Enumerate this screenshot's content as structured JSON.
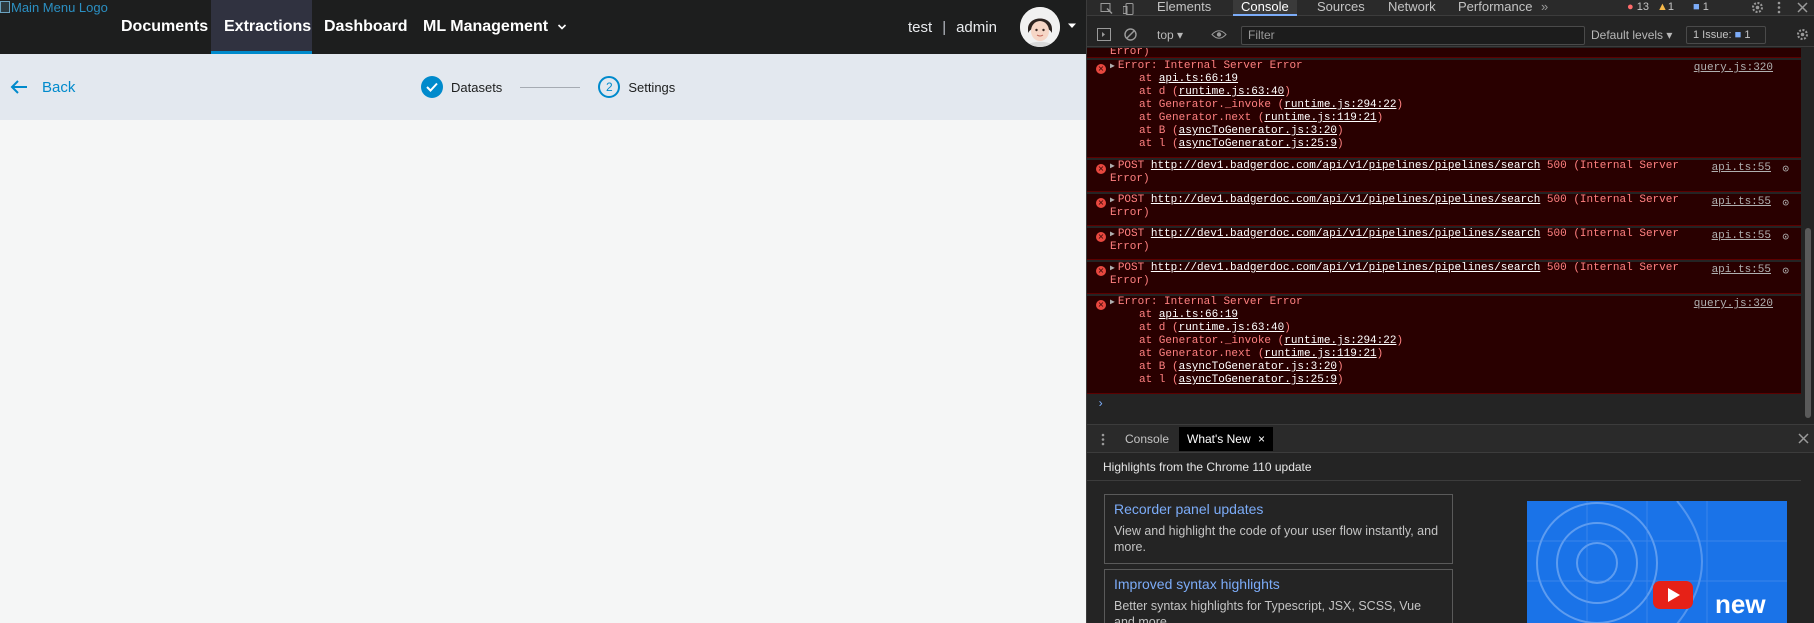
{
  "app": {
    "logo_alt": "Main Menu Logo",
    "nav": [
      {
        "label": "Documents"
      },
      {
        "label": "Extractions"
      },
      {
        "label": "Dashboard"
      },
      {
        "label": "ML Management"
      }
    ],
    "active_nav": "Extractions",
    "user": {
      "tenant": "test",
      "separator": "|",
      "name": "admin"
    },
    "back_label": "Back",
    "steps": [
      {
        "label": "Datasets",
        "status": "done"
      },
      {
        "num": "2",
        "label": "Settings",
        "status": "current"
      }
    ]
  },
  "devtools": {
    "tabs": [
      "Elements",
      "Console",
      "Sources",
      "Network",
      "Performance"
    ],
    "active_tab": "Console",
    "more_tabs": "»",
    "counts": {
      "errors": "13",
      "warnings": "1",
      "messages": "1"
    },
    "toolbar": {
      "context": "top",
      "filter_placeholder": "Filter",
      "levels": "Default levels",
      "issues": "1 Issue:",
      "issue_count": "1"
    },
    "console_lines": {
      "cut_off": "Error)",
      "error1": {
        "head": "Error: Internal Server Error",
        "src": "query.js:320",
        "trace": [
          [
            "at ",
            "api.ts:66:19",
            ""
          ],
          [
            "at d (",
            "runtime.js:63:40",
            ")"
          ],
          [
            "at Generator._invoke (",
            "runtime.js:294:22",
            ")"
          ],
          [
            "at Generator.next (",
            "runtime.js:119:21",
            ")"
          ],
          [
            "at B (",
            "asyncToGenerator.js:3:20",
            ")"
          ],
          [
            "at l (",
            "asyncToGenerator.js:25:9",
            ")"
          ]
        ]
      },
      "post": {
        "method": "POST",
        "url": "http://dev1.badgerdoc.com/api/v1/pipelines/pipelines/search",
        "status": "500 (Internal Server",
        "cont": "Error)",
        "src": "api.ts:55"
      },
      "error2": {
        "head": "Error: Internal Server Error",
        "src": "query.js:320",
        "trace": [
          [
            "at ",
            "api.ts:66:19",
            ""
          ],
          [
            "at d (",
            "runtime.js:63:40",
            ")"
          ],
          [
            "at Generator._invoke (",
            "runtime.js:294:22",
            ")"
          ],
          [
            "at Generator.next (",
            "runtime.js:119:21",
            ")"
          ],
          [
            "at B (",
            "asyncToGenerator.js:3:20",
            ")"
          ],
          [
            "at l (",
            "asyncToGenerator.js:25:9",
            ")"
          ]
        ]
      },
      "prompt": "›"
    },
    "drawer": {
      "tabs": [
        "Console",
        "What's New"
      ],
      "active_tab": "What's New",
      "headline": "Highlights from the Chrome 110 update",
      "cards": [
        {
          "title": "Recorder panel updates",
          "desc": "View and highlight the code of your user flow instantly, and more."
        },
        {
          "title": "Improved syntax highlights",
          "desc": "Better syntax highlights for Typescript, JSX, SCSS, Vue and more."
        }
      ],
      "promo_word": "new"
    }
  }
}
